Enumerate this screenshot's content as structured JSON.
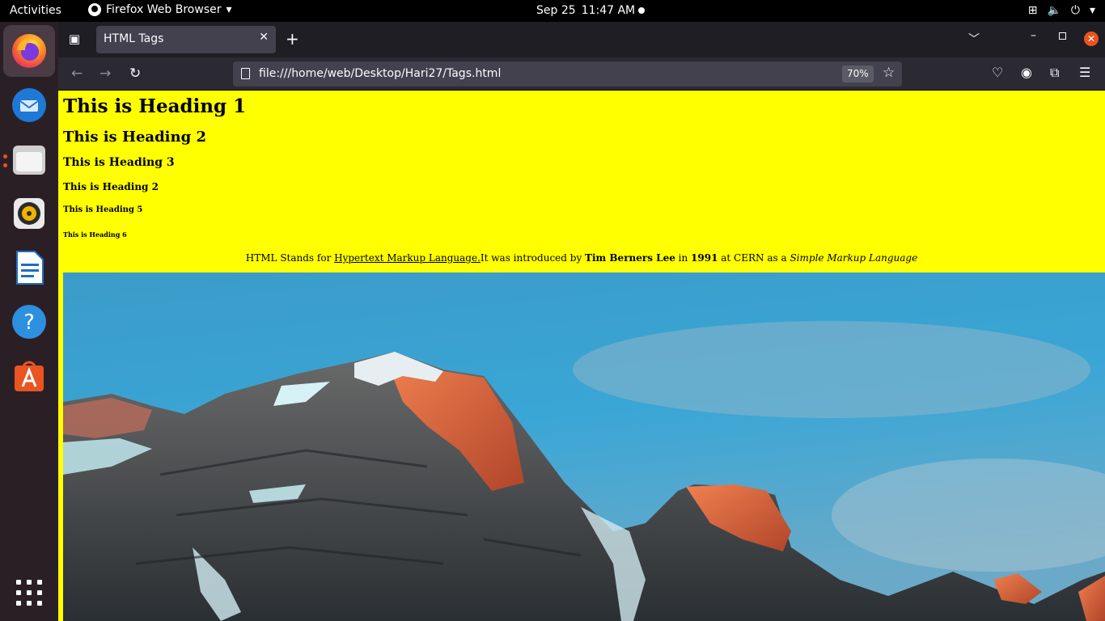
{
  "topbar": {
    "activities": "Activities",
    "app_name": "Firefox Web Browser",
    "date": "Sep 25",
    "time": "11:47 AM"
  },
  "dock": {
    "items": [
      "firefox",
      "thunderbird",
      "files",
      "rhythmbox",
      "libreoffice-writer",
      "help",
      "app-center"
    ]
  },
  "browser": {
    "tab_title": "HTML Tags",
    "url": "file:///home/web/Desktop/Hari27/Tags.html",
    "zoom": "70%"
  },
  "page": {
    "h1": "This is Heading 1",
    "h2": "This is Heading 2",
    "h3": "This is Heading 3",
    "h4": "This is Heading 2",
    "h5": "This is Heading 5",
    "h6": "This is Heading 6",
    "intro": {
      "prefix": "HTML Stands for ",
      "link": "Hypertext Markup Language.",
      "middle1": "It was introduced by ",
      "inventor": "Tim Berners Lee",
      "middle2": " in ",
      "year": "1991",
      "middle3": " at CERN as a ",
      "italic": "Simple Markup Language"
    },
    "background_color": "#ffff00"
  },
  "colors": {
    "accent": "#e95420",
    "tab_bg": "#42414d",
    "toolbar_bg": "#2b2a33"
  }
}
